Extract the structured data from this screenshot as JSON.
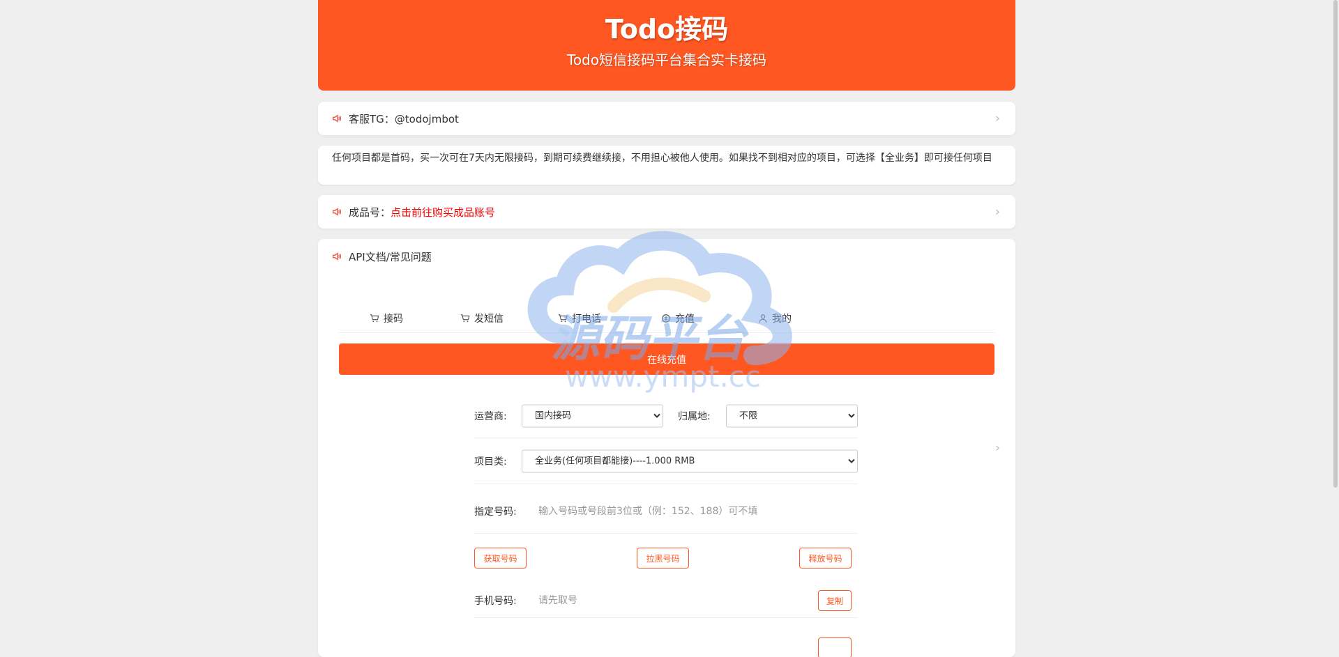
{
  "header": {
    "title": "Todo接码",
    "subtitle": "Todo短信接码平台集合实卡接码"
  },
  "notices": {
    "support": "客服TG：@todojmbot",
    "description": "任何项目都是首码，买一次可在7天内无限接码，到期可续费继续接，不用担心被他人使用。如果找不到相对应的项目，可选择【全业务】即可接任何项目",
    "product_label": "成品号：",
    "product_link": "点击前往购买成品账号",
    "api": "API文档/常见问题"
  },
  "tabs": [
    {
      "label": "接码",
      "icon": "cart-icon"
    },
    {
      "label": "发短信",
      "icon": "cart-icon"
    },
    {
      "label": "打电话",
      "icon": "cart-icon"
    },
    {
      "label": "充值",
      "icon": "coin-icon"
    },
    {
      "label": "我的",
      "icon": "user-icon"
    }
  ],
  "recharge_button": "在线充值",
  "form": {
    "operator_label": "运营商:",
    "operator_value": "国内接码",
    "region_label": "归属地:",
    "region_value": "不限",
    "project_label": "项目类:",
    "project_value": "全业务(任何项目都能接)----1.000 RMB",
    "number_label": "指定号码:",
    "number_placeholder": "输入号码或号段前3位或（例：152、188）可不填",
    "get_number": "获取号码",
    "blacklist_number": "拉黑号码",
    "release_number": "释放号码",
    "phone_label": "手机号码:",
    "phone_placeholder": "请先取号",
    "copy": "复制"
  },
  "watermark": {
    "text": "源码平台",
    "url": "www.ympt.cc"
  },
  "colors": {
    "primary": "#ff5722",
    "link": "#ff0000",
    "speaker": "#e8473a"
  }
}
